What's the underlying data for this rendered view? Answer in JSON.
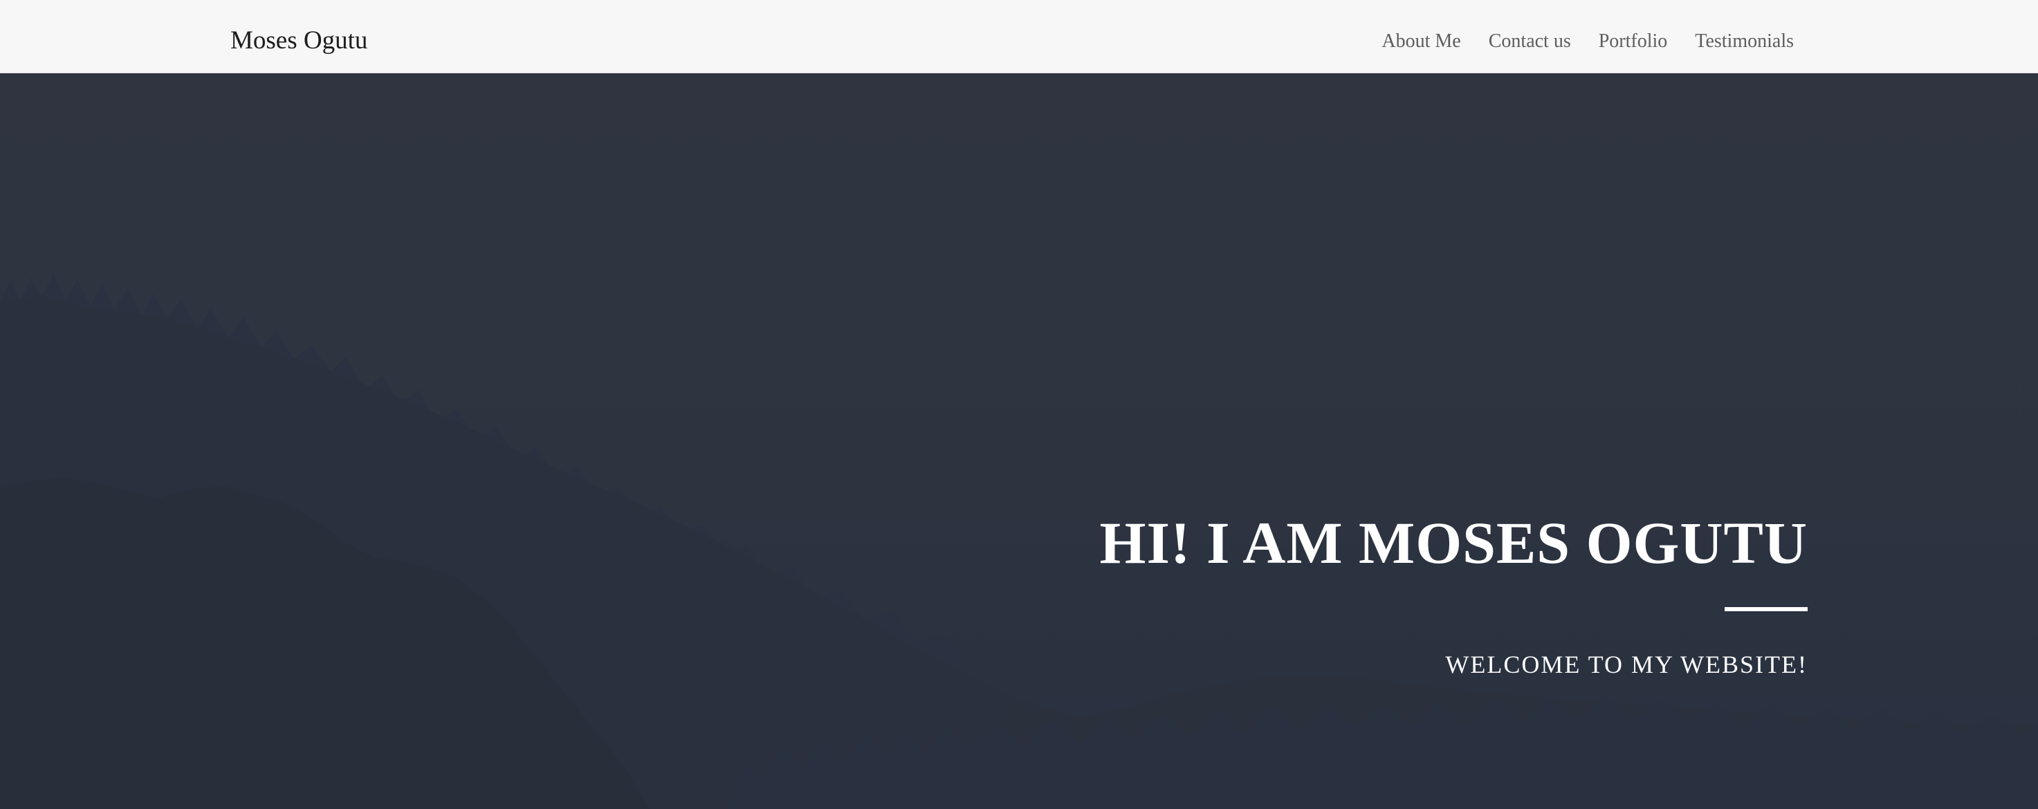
{
  "navbar": {
    "brand": "Moses Ogutu",
    "links": [
      "About Me",
      "Contact us",
      "Portfolio",
      "Testimonials"
    ]
  },
  "hero": {
    "title": "HI! I AM MOSES OGUTU",
    "subtitle": "WELCOME TO MY WEBSITE!",
    "background_image": "forested-hillside-dark-overlay"
  },
  "colors": {
    "navbar_bg": "#f7f7f7",
    "hero_overlay": "#2c3340",
    "hero_text": "#ffffff",
    "nav_link": "#5d5d5d"
  }
}
